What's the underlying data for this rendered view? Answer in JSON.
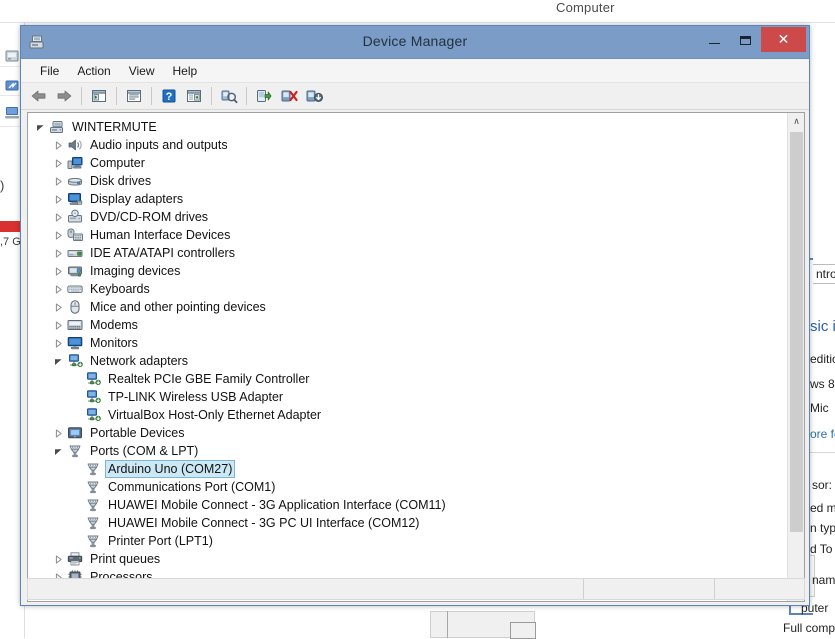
{
  "desktop": {
    "top_label": "Computer",
    "left_fragments": {
      "disk_label": ",7 G",
      "paren": ")"
    },
    "right_fragments": [
      "ntrol",
      "sic i",
      "editio",
      "ws 8",
      " Mic",
      "ore fe",
      "sor:",
      "ed m",
      "n typ",
      "d To",
      " nam",
      "puter ",
      "Full compu"
    ]
  },
  "window": {
    "title": "Device Manager",
    "icon": "device-manager-icon",
    "controls": {
      "minimize": "minimize-button",
      "maximize": "maximize-button",
      "close_label": "✕"
    }
  },
  "menubar": {
    "items": [
      {
        "label": "File"
      },
      {
        "label": "Action"
      },
      {
        "label": "View"
      },
      {
        "label": "Help"
      }
    ]
  },
  "toolbar": {
    "buttons": [
      {
        "name": "back-button",
        "icon": "arrow-left-icon"
      },
      {
        "name": "forward-button",
        "icon": "arrow-right-icon"
      },
      {
        "name": "show-hide-console-tree-button",
        "icon": "console-tree-icon"
      },
      {
        "name": "properties-button",
        "icon": "properties-icon"
      },
      {
        "name": "help-button",
        "icon": "help-question-icon"
      },
      {
        "name": "view-devices-button",
        "icon": "view-list-icon"
      },
      {
        "name": "scan-for-hardware-changes-button",
        "icon": "scan-hardware-icon"
      },
      {
        "name": "update-driver-button",
        "icon": "update-driver-icon"
      },
      {
        "name": "disable-device-button",
        "icon": "disable-device-icon"
      },
      {
        "name": "uninstall-device-button",
        "icon": "uninstall-device-icon"
      }
    ]
  },
  "tree": {
    "nodes": [
      {
        "label": "WINTERMUTE",
        "depth": 0,
        "twisty": "expanded",
        "icon": "computer-tower-icon",
        "selected": false
      },
      {
        "label": "Audio inputs and outputs",
        "depth": 1,
        "twisty": "collapsed",
        "icon": "speaker-icon",
        "selected": false
      },
      {
        "label": "Computer",
        "depth": 1,
        "twisty": "collapsed",
        "icon": "monitor-icon",
        "selected": false
      },
      {
        "label": "Disk drives",
        "depth": 1,
        "twisty": "collapsed",
        "icon": "disk-drive-icon",
        "selected": false
      },
      {
        "label": "Display adapters",
        "depth": 1,
        "twisty": "collapsed",
        "icon": "display-adapter-icon",
        "selected": false
      },
      {
        "label": "DVD/CD-ROM drives",
        "depth": 1,
        "twisty": "collapsed",
        "icon": "dvd-drive-icon",
        "selected": false
      },
      {
        "label": "Human Interface Devices",
        "depth": 1,
        "twisty": "collapsed",
        "icon": "hid-icon",
        "selected": false
      },
      {
        "label": "IDE ATA/ATAPI controllers",
        "depth": 1,
        "twisty": "collapsed",
        "icon": "ide-controller-icon",
        "selected": false
      },
      {
        "label": "Imaging devices",
        "depth": 1,
        "twisty": "collapsed",
        "icon": "camera-icon",
        "selected": false
      },
      {
        "label": "Keyboards",
        "depth": 1,
        "twisty": "collapsed",
        "icon": "keyboard-icon",
        "selected": false
      },
      {
        "label": "Mice and other pointing devices",
        "depth": 1,
        "twisty": "collapsed",
        "icon": "mouse-icon",
        "selected": false
      },
      {
        "label": "Modems",
        "depth": 1,
        "twisty": "collapsed",
        "icon": "modem-icon",
        "selected": false
      },
      {
        "label": "Monitors",
        "depth": 1,
        "twisty": "collapsed",
        "icon": "monitor-screen-icon",
        "selected": false
      },
      {
        "label": "Network adapters",
        "depth": 1,
        "twisty": "expanded",
        "icon": "network-adapter-icon",
        "selected": false
      },
      {
        "label": "Realtek PCIe GBE Family Controller",
        "depth": 2,
        "twisty": "none",
        "icon": "network-adapter-icon",
        "selected": false
      },
      {
        "label": "TP-LINK Wireless USB Adapter",
        "depth": 2,
        "twisty": "none",
        "icon": "network-adapter-icon",
        "selected": false
      },
      {
        "label": "VirtualBox Host-Only Ethernet Adapter",
        "depth": 2,
        "twisty": "none",
        "icon": "network-adapter-icon",
        "selected": false
      },
      {
        "label": "Portable Devices",
        "depth": 1,
        "twisty": "collapsed",
        "icon": "portable-device-icon",
        "selected": false
      },
      {
        "label": "Ports (COM & LPT)",
        "depth": 1,
        "twisty": "expanded",
        "icon": "port-icon",
        "selected": false
      },
      {
        "label": "Arduino Uno (COM27)",
        "depth": 2,
        "twisty": "none",
        "icon": "port-icon",
        "selected": true
      },
      {
        "label": "Communications Port (COM1)",
        "depth": 2,
        "twisty": "none",
        "icon": "port-icon",
        "selected": false
      },
      {
        "label": "HUAWEI Mobile Connect - 3G Application Interface (COM11)",
        "depth": 2,
        "twisty": "none",
        "icon": "port-icon",
        "selected": false
      },
      {
        "label": "HUAWEI Mobile Connect - 3G PC UI Interface (COM12)",
        "depth": 2,
        "twisty": "none",
        "icon": "port-icon",
        "selected": false
      },
      {
        "label": "Printer Port (LPT1)",
        "depth": 2,
        "twisty": "none",
        "icon": "port-icon",
        "selected": false
      },
      {
        "label": "Print queues",
        "depth": 1,
        "twisty": "collapsed",
        "icon": "printer-icon",
        "selected": false
      },
      {
        "label": "Processors",
        "depth": 1,
        "twisty": "collapsed",
        "icon": "processor-icon",
        "selected": false
      }
    ]
  },
  "scrollbar": {
    "up_arrow": "∧",
    "down_arrow": "∨"
  },
  "statusbar": {
    "cells": [
      "",
      "",
      ""
    ]
  },
  "colors": {
    "title_bar": "#7b9cc6",
    "window_border": "#5b84bd",
    "selection_fill": "#cce8f4",
    "selection_border": "#7eb4d6",
    "close_button": "#cc4a4a",
    "accent_link": "#2a6dbd",
    "disk_bar_red": "#d93030"
  }
}
